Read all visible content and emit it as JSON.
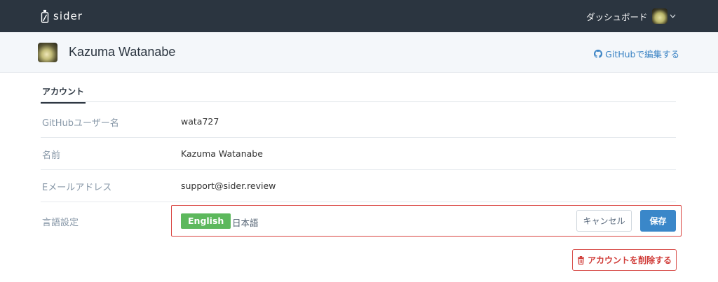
{
  "nav": {
    "brand": "sider",
    "dashboard": "ダッシュボード",
    "user_menu_icon": "chevron-down-icon"
  },
  "header": {
    "user_name": "Kazuma Watanabe",
    "edit_link": "GitHubで編集する",
    "edit_icon": "github-icon"
  },
  "tabs": [
    {
      "label": "アカウント",
      "active": true
    }
  ],
  "fields": [
    {
      "label": "GitHubユーザー名",
      "value": "wata727"
    },
    {
      "label": "名前",
      "value": "Kazuma Watanabe"
    },
    {
      "label": "Eメールアドレス",
      "value": "support@sider.review"
    }
  ],
  "language": {
    "label": "言語設定",
    "options": [
      "English",
      "日本語"
    ],
    "selected": "English",
    "cancel": "キャンセル",
    "save": "保存"
  },
  "delete": {
    "label": "アカウントを削除する",
    "icon": "trash-icon"
  },
  "colors": {
    "topbar": "#2b3540",
    "selected": "#5cb85c",
    "primary": "#3a87c9",
    "danger": "#d9534f",
    "highlight_border": "#d9413d"
  }
}
